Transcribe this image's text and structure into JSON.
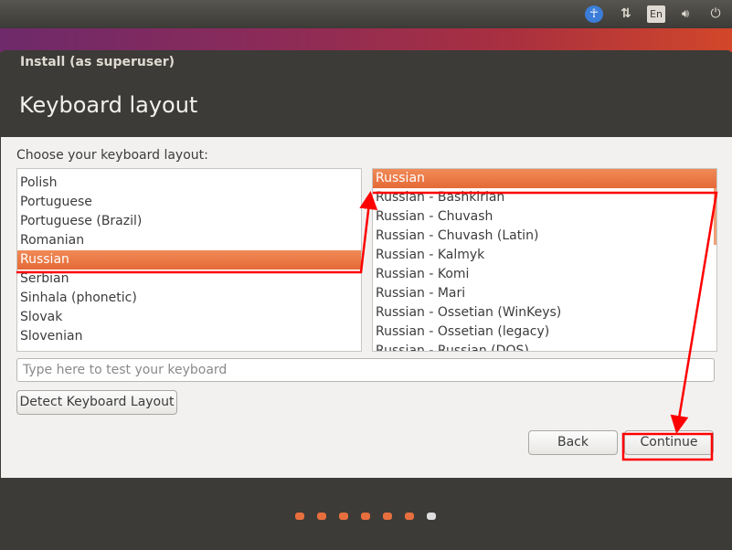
{
  "topbar": {
    "indicators": [
      "accessibility-icon",
      "network-icon",
      "keyboard-language",
      "sound-icon",
      "power-icon"
    ],
    "language": "En"
  },
  "window": {
    "title": "Install (as superuser)",
    "page_title": "Keyboard layout"
  },
  "main": {
    "prompt": "Choose your keyboard layout:",
    "layouts": [
      "Polish",
      "Portuguese",
      "Portuguese (Brazil)",
      "Romanian",
      "Russian",
      "Serbian",
      "Sinhala (phonetic)",
      "Slovak",
      "Slovenian"
    ],
    "selected_layout": "Russian",
    "variants": [
      "Russian",
      "Russian - Bashkirian",
      "Russian - Chuvash",
      "Russian - Chuvash (Latin)",
      "Russian - Kalmyk",
      "Russian - Komi",
      "Russian - Mari",
      "Russian - Ossetian (WinKeys)",
      "Russian - Ossetian (legacy)",
      "Russian - Russian (DOS)"
    ],
    "selected_variant": "Russian",
    "test_placeholder": "Type here to test your keyboard",
    "detect_label": "Detect Keyboard Layout",
    "back_label": "Back",
    "continue_label": "Continue"
  },
  "progress": {
    "completed": 6,
    "total": 7
  },
  "colors": {
    "accent": "#e76f3e",
    "annotation": "#ff0000"
  }
}
